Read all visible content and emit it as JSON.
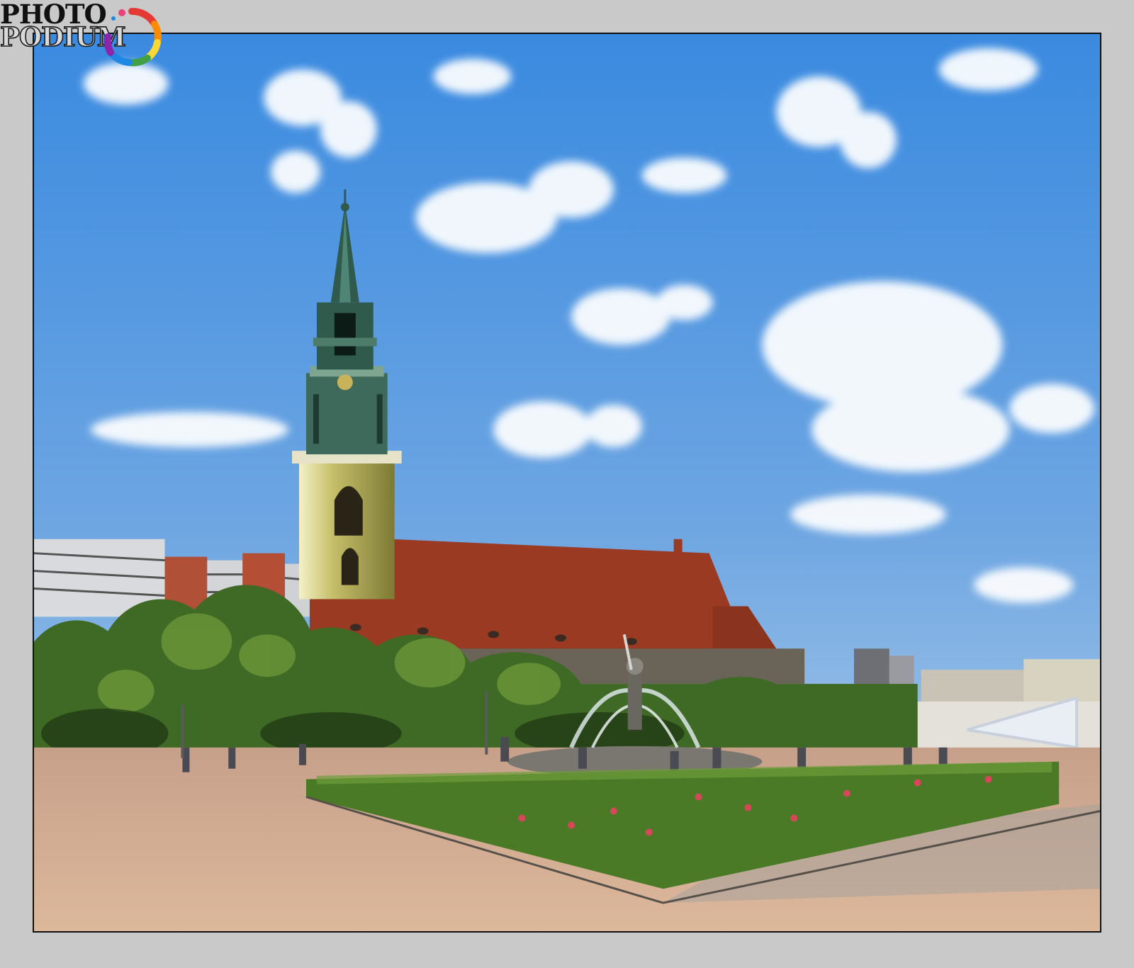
{
  "watermark": {
    "line1": "PHOTO",
    "line2": "PODIUM",
    "colors": [
      "#e53935",
      "#fb8c00",
      "#fdd835",
      "#43a047",
      "#1e88e5",
      "#8e24aa",
      "#ec407a"
    ]
  },
  "scene": {
    "sky_top": "#3e8fdc",
    "sky_bottom": "#a9c9e6",
    "roof_color": "#9a3a23",
    "tower_color": "#b8b25a",
    "spire_color": "#2f5a4c",
    "foliage_color": "#3f6a25",
    "pavement_color": "#d2a98a"
  }
}
